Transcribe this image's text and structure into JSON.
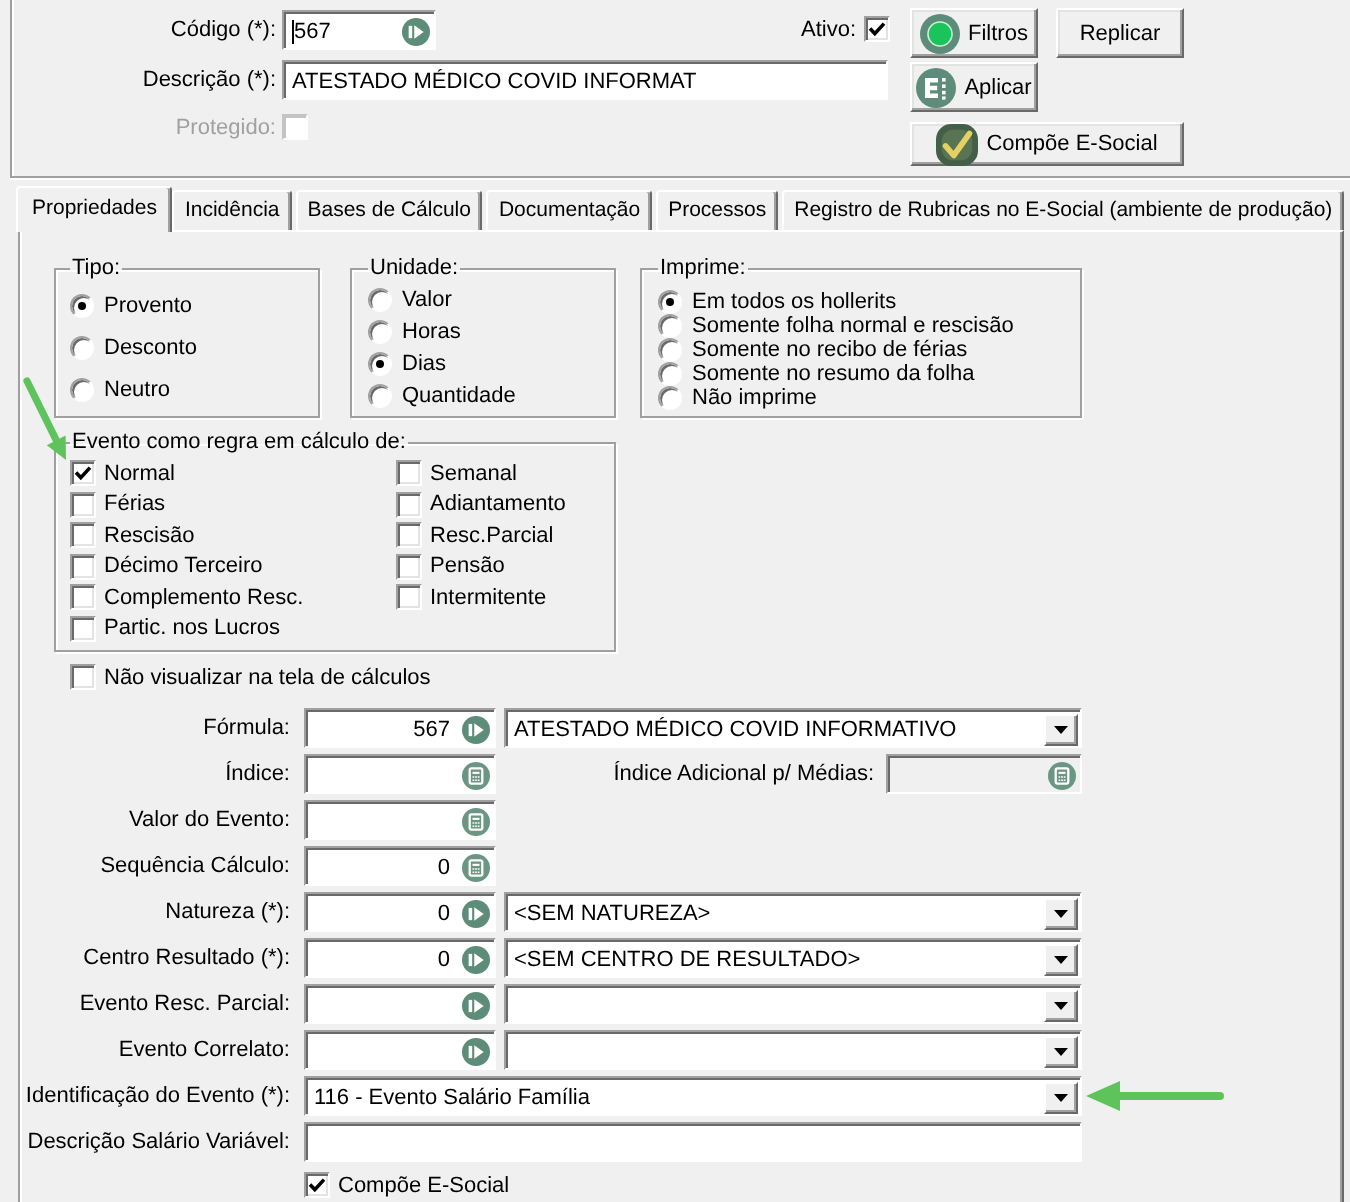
{
  "header": {
    "fields": [
      {
        "kind": "lookup",
        "label": "Código (*):",
        "value": "567",
        "focused": true,
        "disabled": false
      },
      {
        "kind": "text",
        "label": "Descrição (*):",
        "value": "ATESTADO MÉDICO COVID INFORMAT",
        "focused": false,
        "disabled": false
      },
      {
        "kind": "checkbox",
        "label": "Protegido:",
        "checked": false,
        "focused": false,
        "disabled": true
      }
    ],
    "active": {
      "label": "Ativo:",
      "checked": true
    },
    "buttons": [
      {
        "label": "Filtros"
      },
      {
        "label": "Replicar"
      },
      {
        "label": "Aplicar"
      },
      {
        "label": "Compõe E-Social"
      }
    ]
  },
  "tabs": [
    {
      "label": "Propriedades",
      "selected": true
    },
    {
      "label": "Incidência",
      "selected": false
    },
    {
      "label": "Bases de Cálculo",
      "selected": false
    },
    {
      "label": "Documentação",
      "selected": false
    },
    {
      "label": "Processos",
      "selected": false
    },
    {
      "label": "Registro de Rubricas no E-Social (ambiente de produção)",
      "selected": false
    }
  ],
  "option_groups": [
    {
      "title": "Tipo:",
      "options": [
        {
          "label": "Provento",
          "selected": true
        },
        {
          "label": "Desconto",
          "selected": false
        },
        {
          "label": "Neutro",
          "selected": false
        }
      ]
    },
    {
      "title": "Unidade:",
      "options": [
        {
          "label": "Valor",
          "selected": false
        },
        {
          "label": "Horas",
          "selected": false
        },
        {
          "label": "Dias",
          "selected": true
        },
        {
          "label": "Quantidade",
          "selected": false
        }
      ]
    },
    {
      "title": "Imprime:",
      "options": [
        {
          "label": "Em todos os hollerits",
          "selected": true
        },
        {
          "label": "Somente folha normal e rescisão",
          "selected": false
        },
        {
          "label": "Somente no recibo de férias",
          "selected": false
        },
        {
          "label": "Somente no resumo da folha",
          "selected": false
        },
        {
          "label": "Não imprime",
          "selected": false
        }
      ]
    }
  ],
  "calculation_rules": {
    "title": "Evento como regra em cálculo de:",
    "columns": [
      [
        {
          "label": "Normal",
          "checked": true,
          "arrow": true
        },
        {
          "label": "Férias",
          "checked": false,
          "arrow": false
        },
        {
          "label": "Rescisão",
          "checked": false,
          "arrow": false
        },
        {
          "label": "Décimo Terceiro",
          "checked": false,
          "arrow": false
        },
        {
          "label": "Complemento Resc.",
          "checked": false,
          "arrow": false
        },
        {
          "label": "Partic. nos Lucros",
          "checked": false,
          "arrow": false
        }
      ],
      [
        {
          "label": "Semanal",
          "checked": false,
          "arrow": false
        },
        {
          "label": "Adiantamento",
          "checked": false,
          "arrow": false
        },
        {
          "label": "Resc.Parcial",
          "checked": false,
          "arrow": false
        },
        {
          "label": "Pensão",
          "checked": false,
          "arrow": false
        },
        {
          "label": "Intermitente",
          "checked": false,
          "arrow": false
        }
      ]
    ]
  },
  "hide_in_calculation": {
    "label": "Não visualizar na tela de cálculos",
    "checked": false
  },
  "form_rows": [
    {
      "kind": "lookup",
      "label": "Fórmula:",
      "code": "567",
      "combo": "ATESTADO MÉDICO COVID INFORMATIVO",
      "arrow": false
    },
    {
      "kind": "calc",
      "label": "Índice:",
      "extra": {
        "label": "Índice Adicional p/ Médias:",
        "disabled": true
      },
      "arrow": false
    },
    {
      "kind": "calc",
      "label": "Valor do Evento:",
      "arrow": false
    },
    {
      "kind": "calc",
      "label": "Sequência Cálculo:",
      "code": "0",
      "arrow": false
    },
    {
      "kind": "lookup",
      "label": "Natureza (*):",
      "code": "0",
      "combo": "<SEM NATUREZA>",
      "arrow": false
    },
    {
      "kind": "lookup",
      "label": "Centro Resultado (*):",
      "code": "0",
      "combo": "<SEM CENTRO DE RESULTADO>",
      "arrow": false
    },
    {
      "kind": "lookup",
      "label": "Evento Resc. Parcial:",
      "arrow": false
    },
    {
      "kind": "lookup",
      "label": "Evento Correlato:",
      "arrow": false
    },
    {
      "kind": "select",
      "label": "Identificação do Evento (*):",
      "value": "116 - Evento Salário Família",
      "arrow": true
    },
    {
      "kind": "text",
      "label": "Descrição Salário Variável:",
      "arrow": false
    },
    {
      "kind": "checkbox",
      "label": "Compõe E-Social",
      "checked": true,
      "arrow": false
    }
  ]
}
